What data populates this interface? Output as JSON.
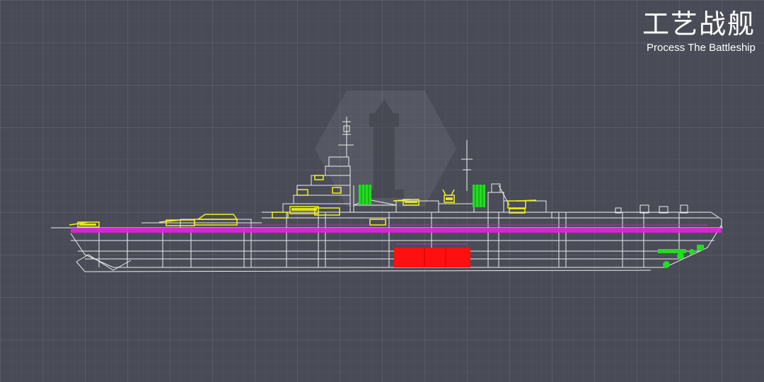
{
  "header": {
    "title_cn": "工艺战舰",
    "title_en": "Process The Battleship"
  },
  "icons": {
    "watermark": "lighthouse-badge-icon"
  },
  "colors": {
    "background": "#494c57",
    "hull_wireframe": "#ffffff",
    "turrets": "#f2f21a",
    "deck_band": "#e024e0",
    "engine_room": "#ff1010",
    "funnels": "#22dd22"
  }
}
